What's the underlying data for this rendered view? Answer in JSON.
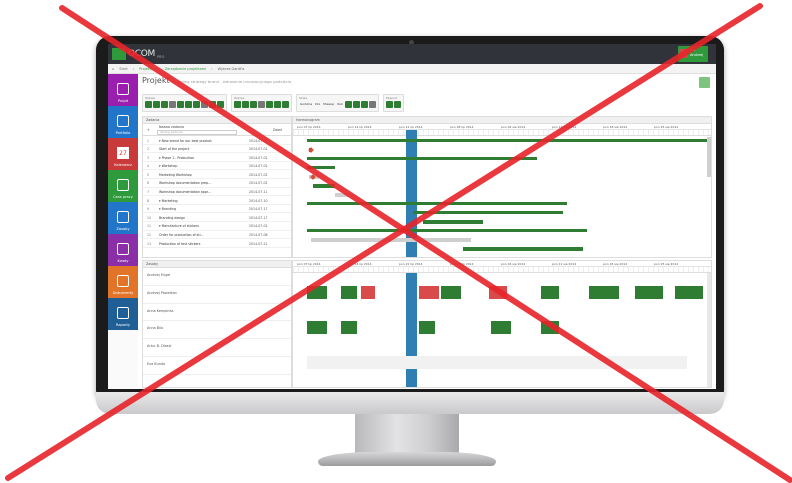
{
  "app": {
    "logo_text": "OCOM",
    "logo_sub": "PRO",
    "user_name": "Jan",
    "user_surname": "Andrzej"
  },
  "breadcrumb": [
    "Start",
    "Projekty",
    "Zarządzanie projektami",
    "Wykres Gantt'a"
  ],
  "page": {
    "title": "Projekt",
    "subtitle": "branding strategy brand - wdrożenie innowacyjnego podejścia"
  },
  "nav": [
    {
      "label": "Pulpit",
      "icon": "monitor-icon",
      "color": "#9b1fae"
    },
    {
      "label": "Portfolio",
      "icon": "chart-line-icon",
      "color": "#2276c9"
    },
    {
      "label": "Kalendarz",
      "icon": "calendar-icon",
      "color": "#c93a3a",
      "number": "27"
    },
    {
      "label": "Czas pracy",
      "icon": "clock-icon",
      "color": "#2e9a3b"
    },
    {
      "label": "Zasoby",
      "icon": "user-icon",
      "color": "#2276c9"
    },
    {
      "label": "Kwoty",
      "icon": "money-icon",
      "color": "#8a2fa8"
    },
    {
      "label": "Dokumenty",
      "icon": "paperclip-icon",
      "color": "#e2742a"
    },
    {
      "label": "Raporty",
      "icon": "bar-chart-icon",
      "color": "#1f5f96"
    }
  ],
  "toolbar": {
    "groups": [
      {
        "label": "Wstaw",
        "buttons": 10
      },
      {
        "label": "Zakres",
        "buttons": 7
      },
      {
        "label": "Skala",
        "buttons": 4,
        "text": [
          "Godzina",
          "Dni",
          "Miesiąc",
          "Rok"
        ]
      },
      {
        "label": "Eksport",
        "buttons": 2
      }
    ]
  },
  "tasks": {
    "panel_title": "Zadania",
    "header_name": "Nazwa zadania",
    "header_dur": "Dzień",
    "search_placeholder": "Szukaj zadania",
    "rows": [
      {
        "num": "1",
        "name": "▾ New brand for our best product",
        "date": "2014-07-01"
      },
      {
        "num": "2",
        "name": "Start of the project",
        "date": "2014-07-01"
      },
      {
        "num": "3",
        "name": "▾ Phase 1 - Production",
        "date": "2014-07-02"
      },
      {
        "num": "4",
        "name": "▾ Workshop",
        "date": "2014-07-02"
      },
      {
        "num": "5",
        "name": "Marketing Workshop",
        "date": "2014-07-02"
      },
      {
        "num": "6",
        "name": "Workshop documentation prep...",
        "date": "2014-07-02"
      },
      {
        "num": "7",
        "name": "Workshop documentation appr...",
        "date": "2014-07-11"
      },
      {
        "num": "8",
        "name": "▾ Marketing",
        "date": "2014-07-10"
      },
      {
        "num": "9",
        "name": "▾ Branding",
        "date": "2014-07-17"
      },
      {
        "num": "10",
        "name": "Branding design",
        "date": "2014-07-17"
      },
      {
        "num": "11",
        "name": "▾ Manufacture of stickers",
        "date": "2014-07-02"
      },
      {
        "num": "12",
        "name": "Order for production of sti...",
        "date": "2014-07-08"
      },
      {
        "num": "13",
        "name": "Production of test stickers",
        "date": "2014-07-21"
      }
    ]
  },
  "gantt": {
    "panel_title": "Harmonogram",
    "weeks": [
      "pon 07 lip 2014",
      "pon 14 lip 2014",
      "pon 21 lip 2014",
      "pon 28 lip 2014",
      "pon 04 sie 2014",
      "pon 11 sie 2014",
      "pon 18 sie 2014",
      "pon 25 sie 2014"
    ]
  },
  "resources": {
    "panel_title": "Zasoby",
    "rows": [
      "Andrzej Engel",
      "Andrzej Pawelkan",
      "Anna Kempinka",
      "Anna Bilo",
      "Artur B. Dłaski",
      "Eva Bundo"
    ]
  },
  "colors": {
    "accent": "#2e7d32",
    "today_marker": "#2f7fb3",
    "overload": "#d94b4b",
    "cross": "#e8242a"
  }
}
